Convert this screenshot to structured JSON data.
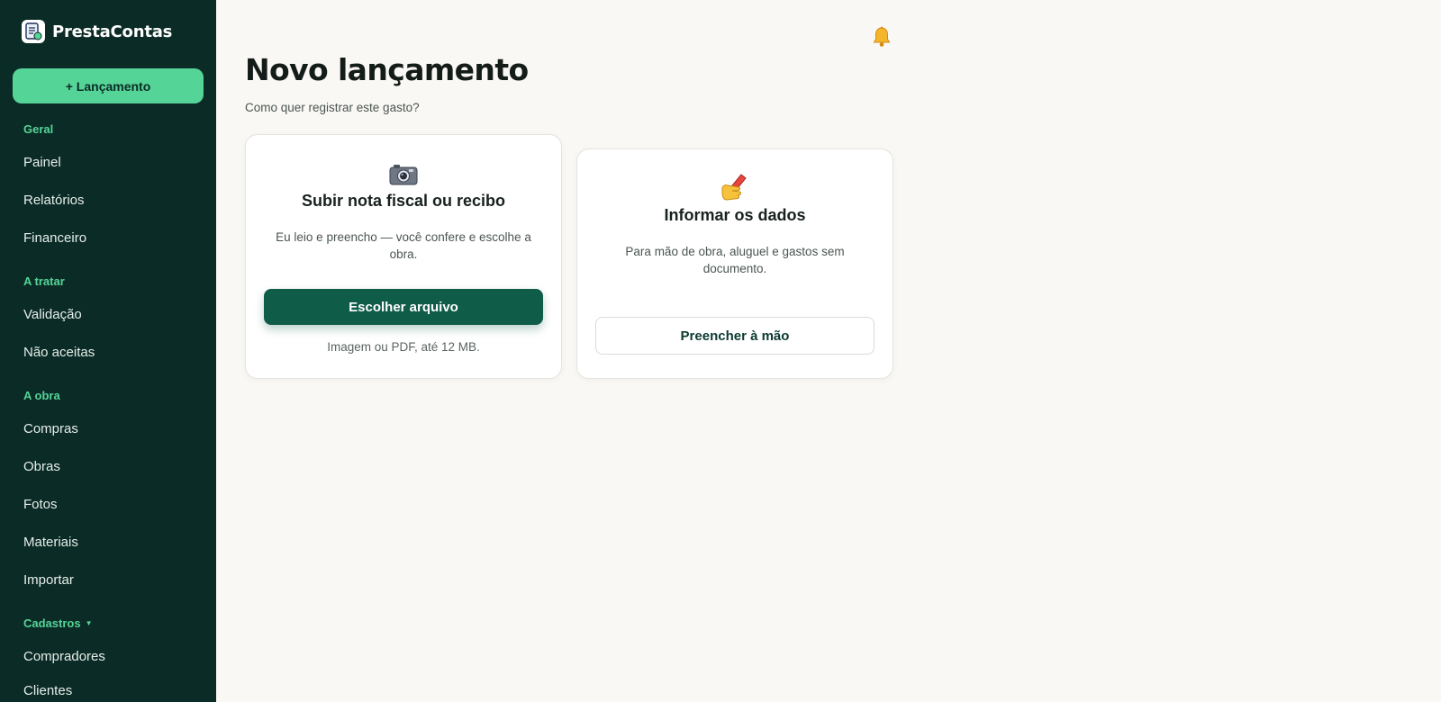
{
  "app": {
    "name": "PrestaContas"
  },
  "sidebar": {
    "new_button": "+ Lançamento",
    "sections": {
      "geral": {
        "label": "Geral",
        "items": [
          "Painel",
          "Relatórios",
          "Financeiro"
        ]
      },
      "a_tratar": {
        "label": "A tratar",
        "items": [
          "Validação",
          "Não aceitas"
        ]
      },
      "a_obra": {
        "label": "A obra",
        "items": [
          "Compras",
          "Obras",
          "Fotos",
          "Materiais",
          "Importar"
        ]
      },
      "cadastros": {
        "label": "Cadastros",
        "items": [
          "Compradores",
          "Clientes"
        ]
      }
    }
  },
  "main": {
    "title": "Novo lançamento",
    "subtitle": "Como quer registrar este gasto?",
    "upload_card": {
      "icon": "camera-icon",
      "title": "Subir nota fiscal ou recibo",
      "description": "Eu leio e preencho — você confere e escolhe a obra.",
      "button": "Escolher arquivo",
      "note": "Imagem ou PDF, até 12 MB."
    },
    "manual_card": {
      "icon": "writing-hand-icon",
      "title": "Informar os dados",
      "description": "Para mão de obra, aluguel e gastos sem documento.",
      "button": "Preencher à mão"
    }
  },
  "colors": {
    "sidebar_bg": "#0b2b26",
    "accent": "#55d497",
    "primary_button": "#0f5c48",
    "page_bg": "#faf8f4"
  }
}
